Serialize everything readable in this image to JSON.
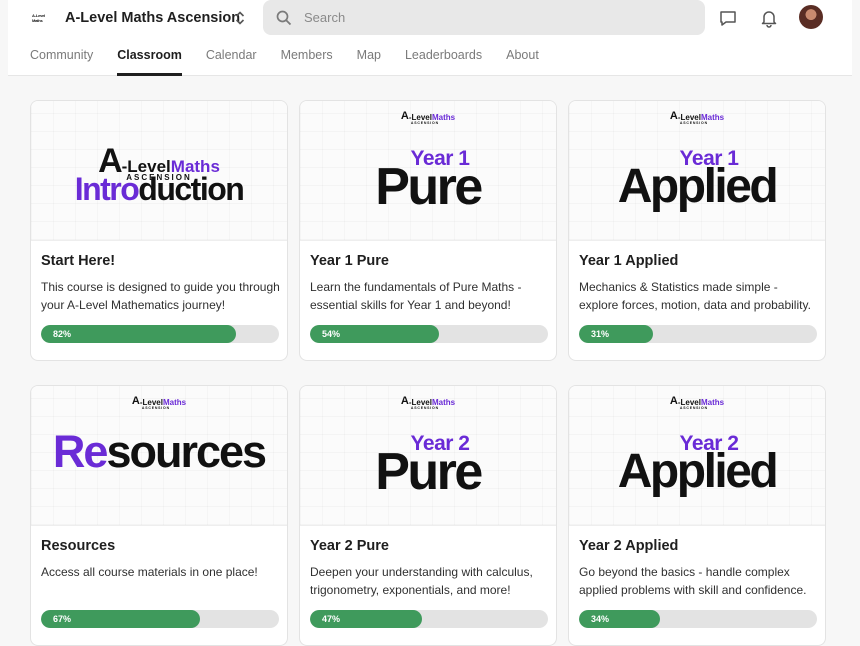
{
  "header": {
    "logo_text": "A-Level Maths",
    "title": "A-Level Maths Ascension",
    "search_placeholder": "Search"
  },
  "tabs": [
    {
      "label": "Community",
      "active": false
    },
    {
      "label": "Classroom",
      "active": true
    },
    {
      "label": "Calendar",
      "active": false
    },
    {
      "label": "Members",
      "active": false
    },
    {
      "label": "Map",
      "active": false
    },
    {
      "label": "Leaderboards",
      "active": false
    },
    {
      "label": "About",
      "active": false
    }
  ],
  "brand": {
    "a": "A",
    "level": "-Level",
    "maths": "Maths",
    "ascension": "ASCENSION"
  },
  "courses": [
    {
      "title": "Start Here!",
      "description": "This course is designed to guide you through your A-Level Mathematics journey!",
      "progress": 82,
      "progress_label": "82%",
      "art": {
        "word_dark": "",
        "word_purple": "Intro",
        "word_rest": "duction"
      }
    },
    {
      "title": "Year 1 Pure",
      "description": "Learn the fundamentals of Pure Maths - essential skills for Year 1 and beyond!",
      "progress": 54,
      "progress_label": "54%",
      "art": {
        "year": "Year 1",
        "word_first": "",
        "word_rest": "Pure"
      }
    },
    {
      "title": "Year 1 Applied",
      "description": "Mechanics & Statistics made simple - explore forces, motion, data and probability.",
      "progress": 31,
      "progress_label": "31%",
      "art": {
        "year": "Year 1",
        "word_first": "A",
        "word_rest": "pplied"
      }
    },
    {
      "title": "Resources",
      "description": "Access all course materials in one place!",
      "progress": 67,
      "progress_label": "67%",
      "art": {
        "word_purple": "Re",
        "word_rest": "sources"
      }
    },
    {
      "title": "Year 2 Pure",
      "description": "Deepen your understanding with calculus, trigonometry, exponentials, and more!",
      "progress": 47,
      "progress_label": "47%",
      "art": {
        "year": "Year 2",
        "word_first": "",
        "word_rest": "Pure"
      }
    },
    {
      "title": "Year 2 Applied",
      "description": "Go beyond the basics - handle complex applied problems with skill and confidence.",
      "progress": 34,
      "progress_label": "34%",
      "art": {
        "year": "Year 2",
        "word_first": "A",
        "word_rest": "pplied"
      }
    }
  ],
  "colors": {
    "brand_purple": "#6a2bd6",
    "progress_green": "#3f9a5c",
    "progress_track": "#e3e3e3"
  }
}
